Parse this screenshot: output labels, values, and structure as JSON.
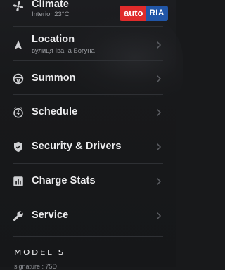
{
  "menu": {
    "items": [
      {
        "id": "climate",
        "label": "Climate",
        "sub": "Interior 23°C",
        "icon": "fan-icon"
      },
      {
        "id": "location",
        "label": "Location",
        "sub": "вулиця Івана Богуна",
        "icon": "navigation-arrow-icon"
      },
      {
        "id": "summon",
        "label": "Summon",
        "sub": "",
        "icon": "steering-wheel-icon"
      },
      {
        "id": "schedule",
        "label": "Schedule",
        "sub": "",
        "icon": "clock-bolt-icon"
      },
      {
        "id": "security",
        "label": "Security & Drivers",
        "sub": "",
        "icon": "shield-icon"
      },
      {
        "id": "charge-stats",
        "label": "Charge Stats",
        "sub": "",
        "icon": "bar-chart-icon"
      },
      {
        "id": "service",
        "label": "Service",
        "sub": "",
        "icon": "wrench-icon"
      }
    ]
  },
  "vehicle": {
    "model_logo": "MODEL S",
    "signature": "signature : 75D"
  },
  "watermark": {
    "left": "auto",
    "right": "RIA"
  },
  "colors": {
    "background": "#18191b",
    "text": "#ececee",
    "subtext": "#9a9ca1",
    "watermark_red": "#e02b2b",
    "watermark_blue": "#2156a8"
  }
}
